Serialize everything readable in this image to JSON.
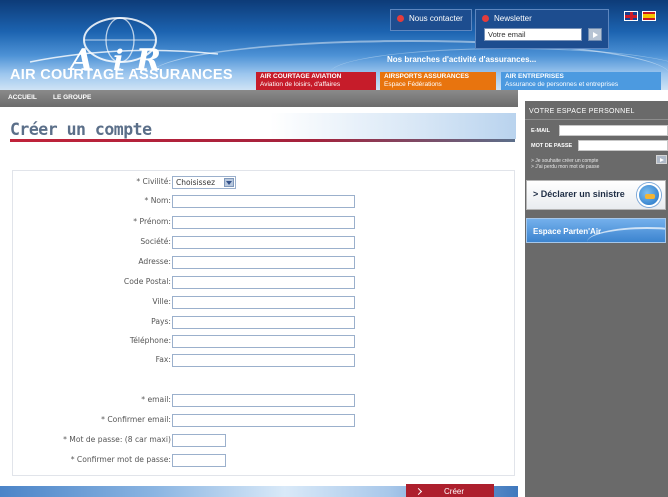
{
  "header": {
    "logo_text": "AIR COURTAGE ASSURANCES",
    "contact_label": "Nous contacter",
    "newsletter_label": "Newsletter",
    "newsletter_placeholder": "Votre email",
    "branches_label": "Nos branches d'activité d'assurances...",
    "branch_tabs": [
      {
        "title": "AIR COURTAGE AVIATION",
        "subtitle": "Aviation de loisirs, d'affaires",
        "color": "#c61c2a"
      },
      {
        "title": "AIRSPORTS ASSURANCES",
        "subtitle": "Espace Fédérations",
        "color": "#e8740e"
      },
      {
        "title": "AIR ENTREPRISES",
        "subtitle": "Assurance de personnes et entreprises",
        "color": "#4c9ae0"
      }
    ]
  },
  "nav": {
    "items": [
      "ACCUEIL",
      "LE GROUPE"
    ]
  },
  "page": {
    "title": "Créer un compte"
  },
  "form": {
    "civility": {
      "label": "* Civilité:",
      "selected": "Choisissez"
    },
    "nom": {
      "label": "* Nom:"
    },
    "prenom": {
      "label": "* Prénom:"
    },
    "societe": {
      "label": "Société:"
    },
    "adresse": {
      "label": "Adresse:"
    },
    "code_postal": {
      "label": "Code Postal:"
    },
    "ville": {
      "label": "Ville:"
    },
    "pays": {
      "label": "Pays:"
    },
    "telephone": {
      "label": "Téléphone:"
    },
    "fax": {
      "label": "Fax:"
    },
    "email": {
      "label": "* email:"
    },
    "confirm_email": {
      "label": "* Confirmer email:"
    },
    "password": {
      "label": "* Mot de passe: (8 car maxi)"
    },
    "confirm_password": {
      "label": "* Confirmer mot de passe:"
    },
    "submit_label": "Créer"
  },
  "sidebar": {
    "account_title": "VOTRE ESPACE PERSONNEL",
    "email_label": "E-MAIL",
    "password_label": "MOT DE PASSE",
    "create_link": "> Je souhaite créer un compte",
    "lost_link": "> J'ai perdu mon mot de passe",
    "sinistre_label": "> Déclarer un sinistre",
    "partenair_label": "Espace Parten'Air"
  },
  "colors": {
    "header_blue": "#1c63b0",
    "accent_red": "#ad1f2d",
    "title_grey_blue": "#5b6f89",
    "sidebar_grey": "#6a6a6a"
  }
}
